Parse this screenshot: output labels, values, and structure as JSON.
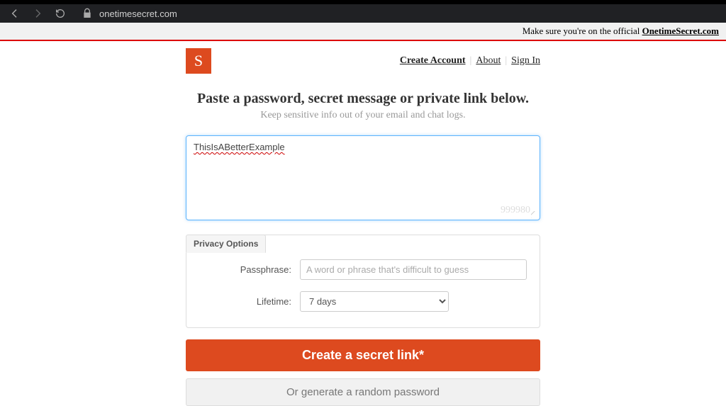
{
  "browser": {
    "url": "onetimesecret.com"
  },
  "banner": {
    "prefix": "Make sure you're on the official ",
    "link": "OnetimeSecret.com"
  },
  "logo": {
    "letter": "S"
  },
  "nav": {
    "create_account": "Create Account",
    "about": "About",
    "sign_in": "Sign In"
  },
  "heading": "Paste a password, secret message or private link below.",
  "subheading": "Keep sensitive info out of your email and chat logs.",
  "secret": {
    "value": "ThisIsABetterExample",
    "char_count": "999980"
  },
  "privacy": {
    "title": "Privacy Options",
    "passphrase_label": "Passphrase:",
    "passphrase_placeholder": "A word or phrase that's difficult to guess",
    "lifetime_label": "Lifetime:",
    "lifetime_value": "7 days"
  },
  "buttons": {
    "create": "Create a secret link*",
    "generate": "Or generate a random password"
  }
}
